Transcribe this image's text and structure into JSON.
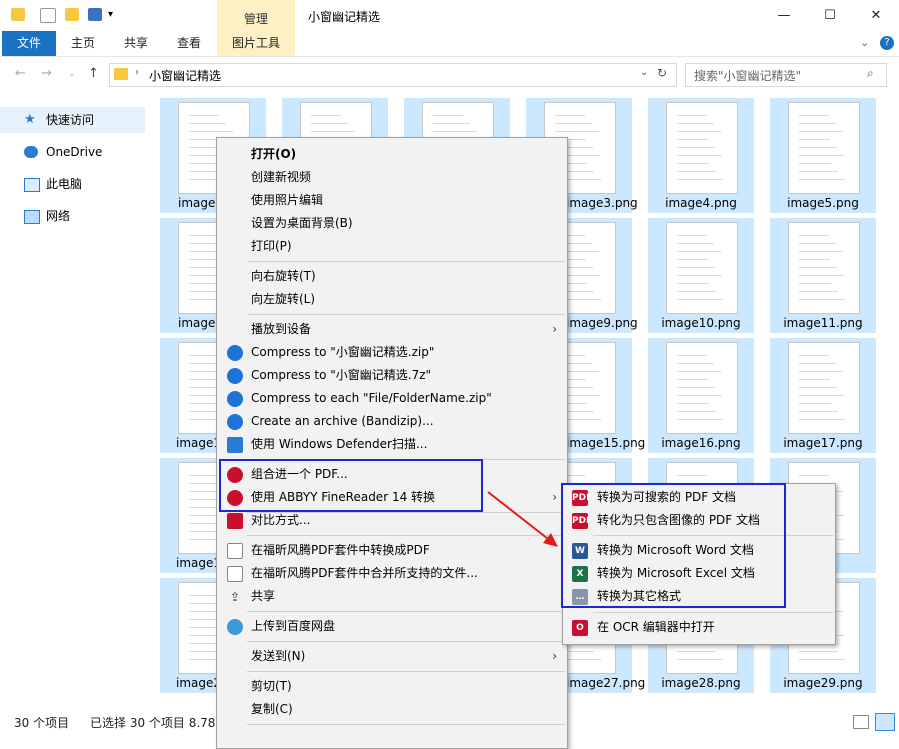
{
  "window": {
    "title": "小窗幽记精选",
    "manage_tab": "管理"
  },
  "ribbon": {
    "tabs": [
      "文件",
      "主页",
      "共享",
      "查看",
      "图片工具"
    ]
  },
  "address": {
    "crumb": "小窗幽记精选",
    "search_placeholder": "搜索\"小窗幽记精选\""
  },
  "nav": {
    "items": [
      "快速访问",
      "OneDrive",
      "此电脑",
      "网络"
    ]
  },
  "files": [
    "image",
    "",
    "image3.png",
    "image4.png",
    "image5.png",
    "image",
    "",
    "image9.png",
    "image10.png",
    "image11.png",
    "image1",
    "",
    "image15.png",
    "image16.png",
    "image17.png",
    "image1",
    "",
    "",
    "image",
    "image",
    "image2",
    "",
    "image27.png",
    "image28.png",
    "image29.png"
  ],
  "status": {
    "count": "30 个项目",
    "selected": "已选择 30 个项目  8.78"
  },
  "context_menu": {
    "items": [
      "打开(O)",
      "创建新视频",
      "使用照片编辑",
      "设置为桌面背景(B)",
      "打印(P)",
      "向右旋转(T)",
      "向左旋转(L)",
      "播放到设备",
      "Compress to \"小窗幽记精选.zip\"",
      "Compress to \"小窗幽记精选.7z\"",
      "Compress to each \"File/FolderName.zip\"",
      "Create an archive (Bandizip)...",
      "使用 Windows Defender扫描...",
      "组合进一个 PDF...",
      "使用 ABBYY FineReader 14 转换",
      "对比方式...",
      "在福昕风腾PDF套件中转换成PDF",
      "在福昕风腾PDF套件中合并所支持的文件...",
      "共享",
      "上传到百度网盘",
      "发送到(N)",
      "剪切(T)",
      "复制(C)"
    ]
  },
  "submenu": {
    "items": [
      "转换为可搜索的 PDF 文档",
      "转化为只包含图像的 PDF 文档",
      "转换为 Microsoft Word 文档",
      "转换为 Microsoft Excel 文档",
      "转换为其它格式",
      "在 OCR 编辑器中打开"
    ]
  },
  "colors": {
    "accent": "#1a73c2",
    "selection": "#cce8ff",
    "highlight_box": "#1d28d0",
    "arrow": "#e11b1b"
  }
}
